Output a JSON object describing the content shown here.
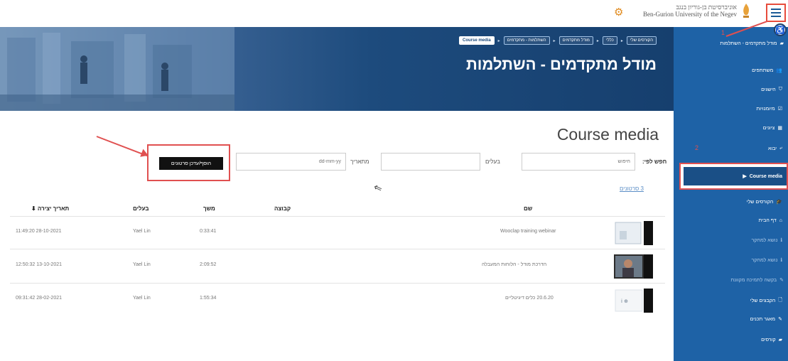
{
  "topbar": {
    "logo_hebrew": "אוניברסיטת בן-גוריון בנגב",
    "logo_english": "Ben-Gurion University of the Negev"
  },
  "banner": {
    "title": "מודל מתקדמים - השתלמות",
    "breadcrumbs": [
      "הקורסים שלי",
      "כללי",
      "מודל מתקדמים",
      "השתלמות - מתקדמים",
      "Course media"
    ]
  },
  "sidebar": {
    "items": [
      {
        "label": "מודל מתקדמים - השתלמות",
        "icon": "▰"
      },
      {
        "label": "משתתפים",
        "icon": "👥"
      },
      {
        "label": "הישגים",
        "icon": "⛉"
      },
      {
        "label": "מיומנויות",
        "icon": "☑"
      },
      {
        "label": "ציונים",
        "icon": "▦"
      },
      {
        "label": "יבוא",
        "icon": "⤶"
      },
      {
        "label": "Course media",
        "icon": "▶"
      },
      {
        "label": "הקורסים שלי",
        "icon": "🎓"
      },
      {
        "label": "דף הבית",
        "icon": "⌂"
      },
      {
        "label": "נושא למחקר",
        "icon": "ℹ"
      },
      {
        "label": "נושא למחקר",
        "icon": "ℹ"
      },
      {
        "label": "בקשה לתמיכה מקוונת",
        "icon": "✎"
      },
      {
        "label": "הקבצים שלי",
        "icon": "🗋"
      },
      {
        "label": "מאגר תכנים",
        "icon": "✎"
      },
      {
        "label": "קורסים",
        "icon": "▰"
      }
    ]
  },
  "annotations": {
    "step1": "1",
    "step2": "2"
  },
  "main": {
    "heading": "Course media",
    "search_label": "חפש לפי:",
    "search_placeholder": "חיפוש",
    "owner_label": "בעלים",
    "date_label": "מתאריך",
    "date_placeholder": "dd-mm-yy",
    "add_button": "הוסף/עדכן סרטונים",
    "filter_link": "3 סרטונים",
    "columns": {
      "name": "שם",
      "group": "קבוצה",
      "duration": "משך",
      "owner": "בעלים",
      "created": "תאריך יצירה ⬇"
    },
    "rows": [
      {
        "name": "Wooclap training webinar",
        "duration": "0:33:41",
        "owner": "Yael Lin",
        "created": "11:49:20 28-10-2021"
      },
      {
        "name": "הדרכת מודל - הלוחות המעבלה",
        "duration": "2:09:52",
        "owner": "Yael Lin",
        "created": "12:50:32 13-10-2021"
      },
      {
        "name": "20.6.20 כלים דיגיטליים",
        "duration": "1:55:34",
        "owner": "Yael Lin",
        "created": "09:31:42 28-02-2021"
      }
    ]
  }
}
